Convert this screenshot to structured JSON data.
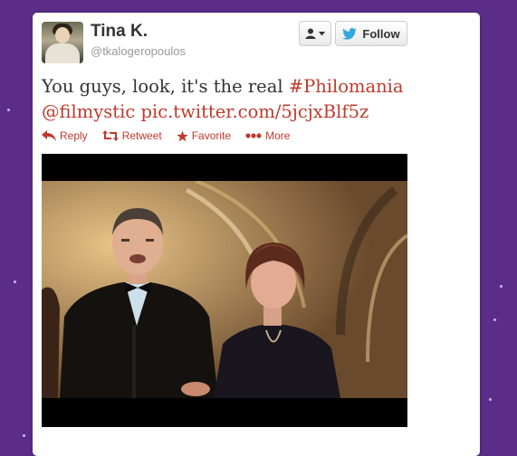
{
  "tweet": {
    "author_name": "Tina K.",
    "author_handle": "@tkalogeropoulos",
    "text_plain": "You guys, look, it's the real ",
    "hashtag": "#Philomania",
    "mention": "@filmystic",
    "pic_link": "pic.twitter.com/5jcjxBlf5z"
  },
  "buttons": {
    "follow_label": "Follow"
  },
  "actions": [
    {
      "label": "Reply",
      "icon": "reply-icon"
    },
    {
      "label": "Retweet",
      "icon": "retweet-icon"
    },
    {
      "label": "Favorite",
      "icon": "star-icon"
    },
    {
      "label": "More",
      "icon": "more-icon"
    }
  ],
  "colors": {
    "background": "#5b2d88",
    "link": "#c0392b",
    "twitter_blue": "#2fa9e0"
  }
}
